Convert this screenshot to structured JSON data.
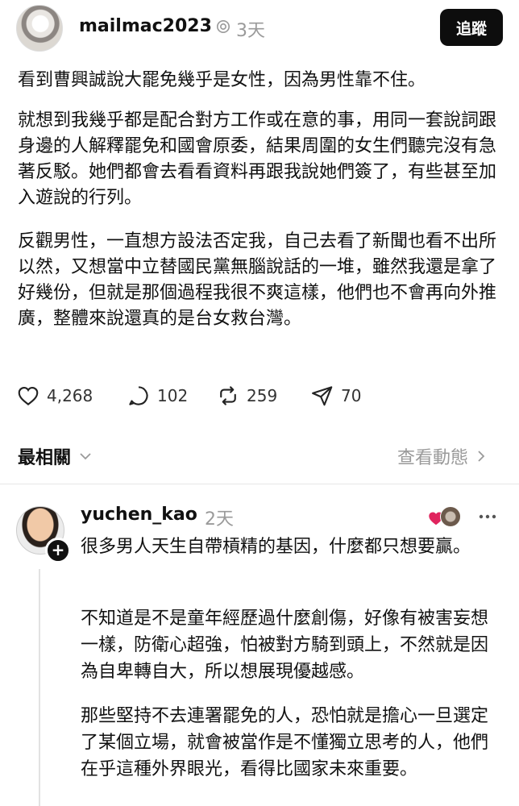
{
  "post": {
    "author": "mailmac2023",
    "time": "3天",
    "follow_label": "追蹤",
    "paragraphs": [
      "看到曹興誠說大罷免幾乎是女性，因為男性靠不住。",
      "就想到我幾乎都是配合對方工作或在意的事，用同一套說詞跟身邊的人解釋罷免和國會原委，結果周圍的女生們聽完沒有急著反駁。她們都會去看看資料再跟我說她們簽了，有些甚至加入遊說的行列。",
      "反觀男性，一直想方設法否定我，自己去看了新聞也看不出所以然，又想當中立替國民黨無腦說話的一堆，雖然我還是拿了好幾份，但就是那個過程我很不爽這樣，他們也不會再向外推廣，整體來說還真的是台女救台灣。"
    ],
    "stats": {
      "likes": "4,268",
      "replies": "102",
      "reposts": "259",
      "shares": "70"
    }
  },
  "sort": {
    "label": "最相關",
    "view_activity": "查看動態"
  },
  "reply": {
    "author": "yuchen_kao",
    "time": "2天",
    "paragraphs": [
      "很多男人天生自帶槓精的基因，什麼都只想要贏。",
      "不知道是不是童年經歷過什麼創傷，好像有被害妄想一樣，防衛心超強，怕被對方騎到頭上，不然就是因為自卑轉自大，所以想展現優越感。",
      "那些堅持不去連署罷免的人，恐怕就是擔心一旦選定了某個立場，就會被當作是不懂獨立思考的人，他們在乎這種外界眼光，看得比國家未來重要。"
    ]
  },
  "icons": [
    "verified-icon",
    "heart-icon",
    "comment-icon",
    "repost-icon",
    "share-icon",
    "chevron-down-icon",
    "chevron-right-icon",
    "plus-icon",
    "more-icon"
  ],
  "colors": {
    "text": "#111111",
    "muted": "#9a9a9a",
    "button_bg": "#0d0d0d",
    "heart": "#e0245e"
  }
}
